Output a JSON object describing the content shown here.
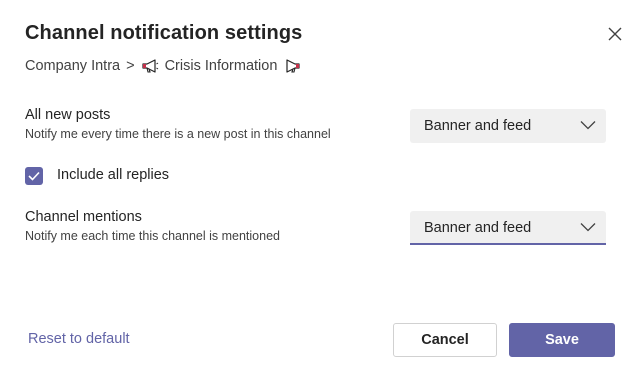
{
  "dialog": {
    "title": "Channel notification settings",
    "close_icon": "close-icon"
  },
  "breadcrumb": {
    "team": "Company Intra",
    "separator": ">",
    "channel": "Crisis Information",
    "channel_icon": "megaphone-icon"
  },
  "settings": {
    "all_posts": {
      "title": "All new posts",
      "description": "Notify me every time there is a new post in this channel",
      "selected": "Banner and feed"
    },
    "include_replies": {
      "label": "Include all replies",
      "checked": true
    },
    "mentions": {
      "title": "Channel mentions",
      "description": "Notify me each time this channel is mentioned",
      "selected": "Banner and feed"
    }
  },
  "footer": {
    "reset_label": "Reset to default",
    "cancel_label": "Cancel",
    "save_label": "Save"
  },
  "colors": {
    "accent": "#6264a7",
    "dropdown_bg": "#f0f0f0",
    "text": "#242424"
  }
}
